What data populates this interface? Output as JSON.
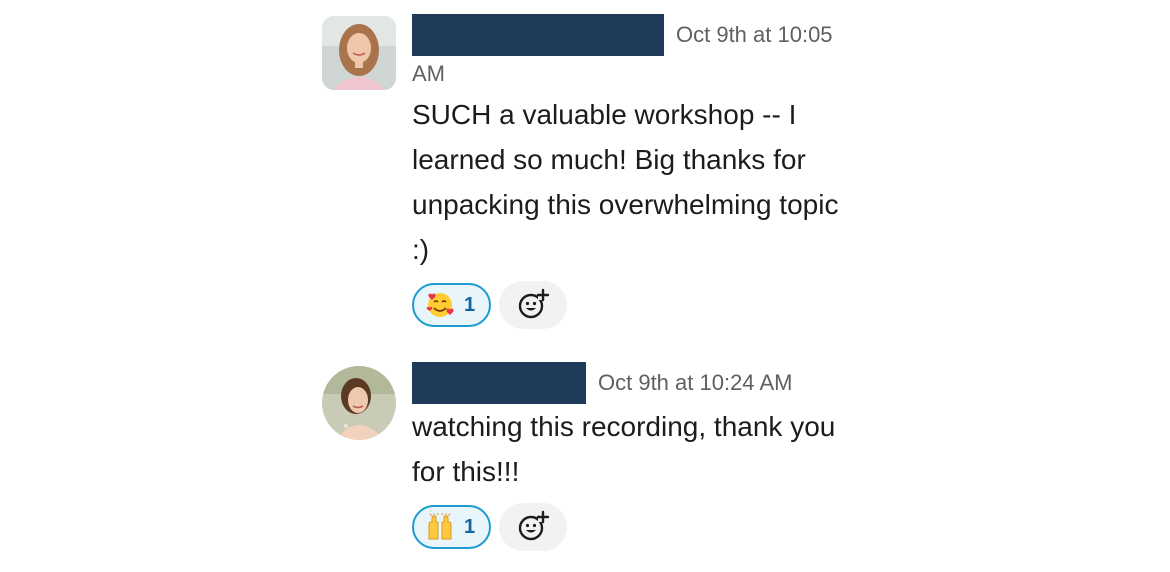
{
  "messages": [
    {
      "timestamp": "Oct 9th at 10:05 AM",
      "timestamp_part1": "Oct 9th at 10:05",
      "timestamp_part2": "AM",
      "text": "SUCH a valuable workshop -- I learned so much! Big thanks for unpacking this overwhelming topic :)",
      "reaction": {
        "emoji": "smiling-face-with-hearts",
        "count": "1"
      }
    },
    {
      "timestamp": "Oct 9th at 10:24 AM",
      "text": "watching this recording, thank you for this!!!",
      "reaction": {
        "emoji": "raising-hands",
        "count": "1"
      }
    }
  ],
  "colors": {
    "name_redaction": "#1f3b5a",
    "reaction_border": "#1d9bd1",
    "reaction_bg": "#e8f5fa",
    "reaction_count": "#1264a3",
    "add_reaction_bg": "#f2f2f2"
  }
}
